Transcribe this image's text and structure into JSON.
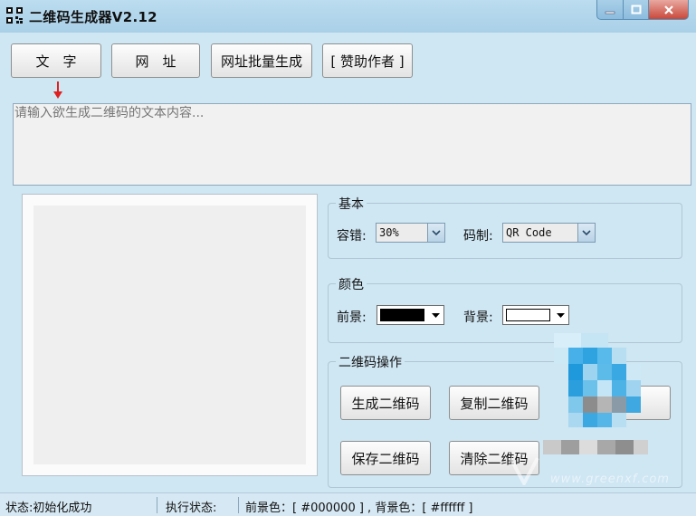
{
  "window": {
    "title": "二维码生成器V2.12"
  },
  "toolbar": {
    "text_label": "文　字",
    "url_label": "网　址",
    "batch_label": "网址批量生成",
    "donate_label": "[ 赞助作者 ]"
  },
  "input": {
    "placeholder": "请输入欲生成二维码的文本内容..."
  },
  "basic": {
    "title": "基本",
    "ec_label": "容错:",
    "ec_value": "30%",
    "type_label": "码制:",
    "type_value": "QR Code"
  },
  "color": {
    "title": "颜色",
    "fg_label": "前景:",
    "bg_label": "背景:",
    "fg_hex": "#000000",
    "bg_hex": "#ffffff"
  },
  "ops": {
    "title": "二维码操作",
    "generate_label": "生成二维码",
    "copy_label": "复制二维码",
    "save_label": "保存二维码",
    "clear_label": "清除二维码"
  },
  "status": {
    "state": "状态:初始化成功",
    "exec": "执行状态:",
    "colors": "前景色：[ #000000 ] , 背景色：[ #ffffff ]"
  },
  "watermark": {
    "site": "www.greenxf.com"
  },
  "theme": {
    "accent": "#a9d0e8",
    "client_bg": "#cfe6f3",
    "arrow": "#e02020"
  }
}
